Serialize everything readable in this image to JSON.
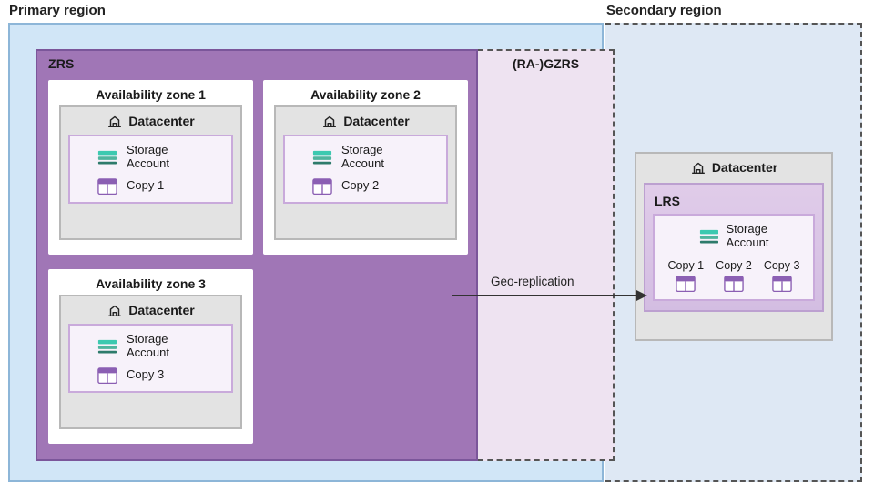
{
  "primary": {
    "region_label": "Primary region",
    "zrs_title": "ZRS",
    "zones": [
      {
        "title": "Availability zone 1",
        "dc_label": "Datacenter",
        "storage_label": "Storage\nAccount",
        "copy_label": "Copy 1"
      },
      {
        "title": "Availability zone 2",
        "dc_label": "Datacenter",
        "storage_label": "Storage\nAccount",
        "copy_label": "Copy 2"
      },
      {
        "title": "Availability zone 3",
        "dc_label": "Datacenter",
        "storage_label": "Storage\nAccount",
        "copy_label": "Copy 3"
      }
    ]
  },
  "gzrs_title": "(RA-)GZRS",
  "secondary": {
    "region_label": "Secondary region",
    "dc_label": "Datacenter",
    "lrs_title": "LRS",
    "storage_label": "Storage\nAccount",
    "copies": [
      "Copy 1",
      "Copy 2",
      "Copy 3"
    ]
  },
  "geo_replication_label": "Geo-replication"
}
